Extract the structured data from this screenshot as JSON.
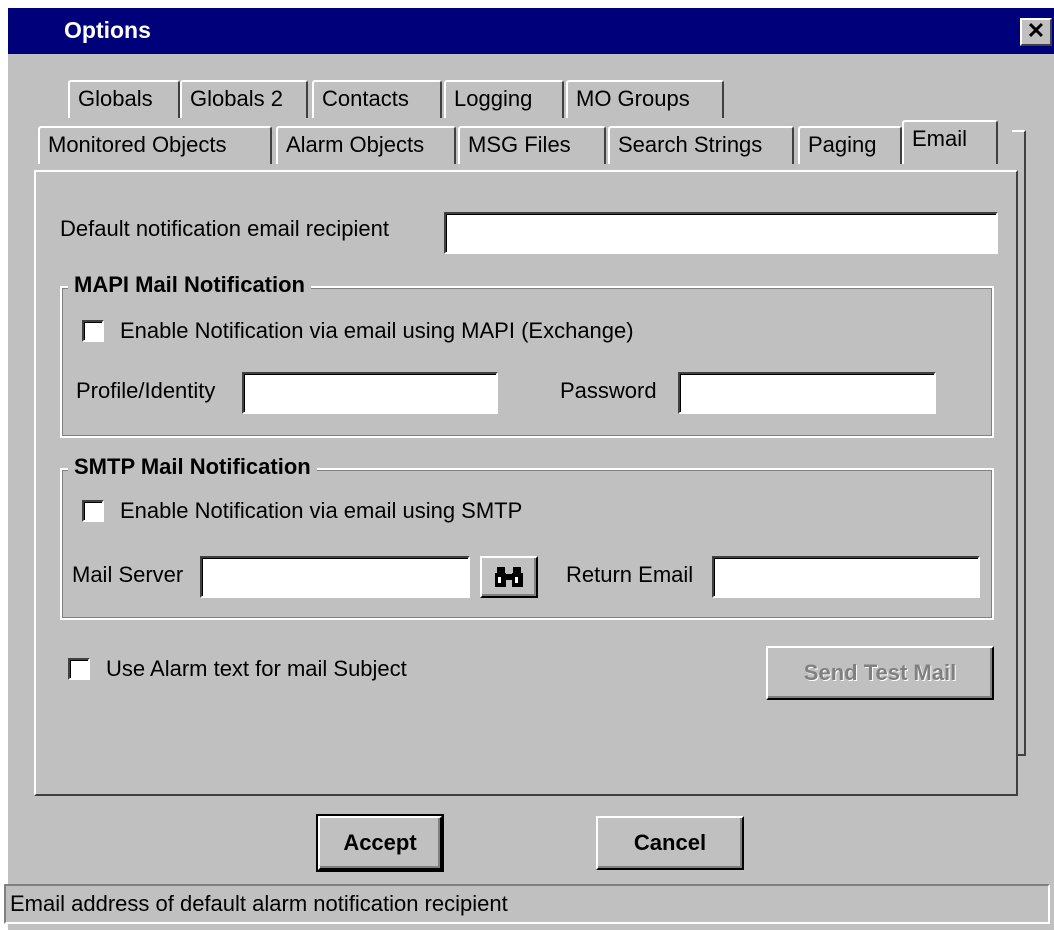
{
  "window": {
    "title": "Options",
    "close_glyph": "✕"
  },
  "tabs_row1": [
    "Globals",
    "Globals 2",
    "Contacts",
    "Logging",
    "MO Groups"
  ],
  "tabs_row2": [
    "Monitored Objects",
    "Alarm Objects",
    "MSG Files",
    "Search Strings",
    "Paging",
    "Email"
  ],
  "active_tab": "Email",
  "email": {
    "default_recipient_label": "Default notification email recipient",
    "default_recipient_value": "",
    "mapi": {
      "group_title": "MAPI Mail Notification",
      "enable_label": "Enable Notification via email using MAPI (Exchange)",
      "enable_checked": false,
      "profile_label": "Profile/Identity",
      "profile_value": "",
      "password_label": "Password",
      "password_value": ""
    },
    "smtp": {
      "group_title": "SMTP Mail Notification",
      "enable_label": "Enable Notification via email using SMTP",
      "enable_checked": false,
      "server_label": "Mail Server",
      "server_value": "",
      "browse_icon": "binoculars-icon",
      "return_label": "Return Email",
      "return_value": ""
    },
    "use_alarm_subject_label": "Use Alarm text for mail Subject",
    "use_alarm_subject_checked": false,
    "send_test_label": "Send Test Mail"
  },
  "buttons": {
    "accept": "Accept",
    "cancel": "Cancel"
  },
  "status_text": "Email address of default alarm notification recipient",
  "colors": {
    "titlebar": "#00007b",
    "face": "#c0c0c0"
  }
}
